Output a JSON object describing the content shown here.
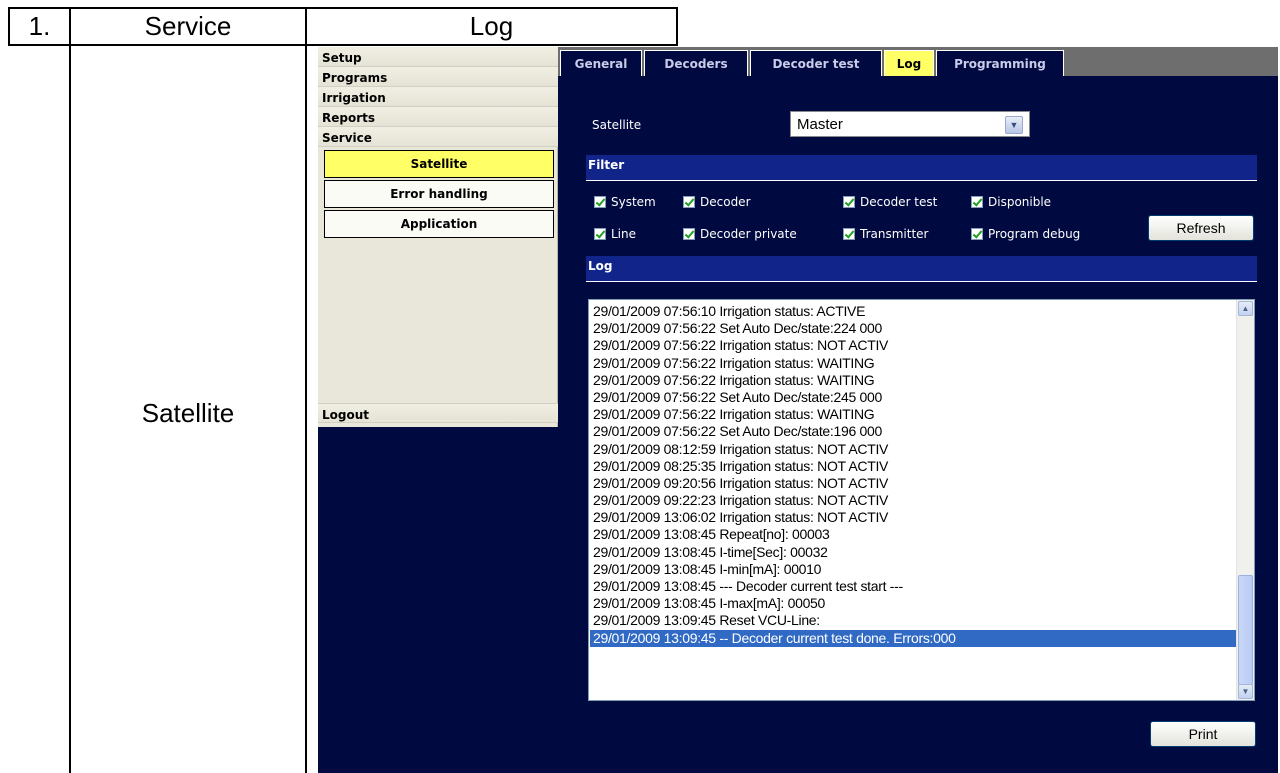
{
  "doc": {
    "number": "1.",
    "section": "Service",
    "subsection": "Log",
    "left_label": "Satellite"
  },
  "app": {
    "menu": [
      "Setup",
      "Programs",
      "Irrigation",
      "Reports",
      "Service"
    ],
    "submenu": [
      {
        "label": "Satellite",
        "active": true
      },
      {
        "label": "Error handling",
        "active": false
      },
      {
        "label": "Application",
        "active": false
      }
    ],
    "logout": "Logout",
    "tabs": [
      {
        "label": "General",
        "active": false
      },
      {
        "label": "Decoders",
        "active": false
      },
      {
        "label": "Decoder test",
        "active": false
      },
      {
        "label": "Log",
        "active": true
      },
      {
        "label": "Programming",
        "active": false
      }
    ],
    "satellite_label": "Satellite",
    "satellite_value": "Master",
    "filter_title": "Filter",
    "filters": [
      {
        "label": "System",
        "checked": true
      },
      {
        "label": "Decoder",
        "checked": true
      },
      {
        "label": "Decoder test",
        "checked": true
      },
      {
        "label": "Disponible",
        "checked": true
      },
      {
        "label": "Line",
        "checked": true
      },
      {
        "label": "Decoder private",
        "checked": true
      },
      {
        "label": "Transmitter",
        "checked": true
      },
      {
        "label": "Program debug",
        "checked": true
      }
    ],
    "refresh_label": "Refresh",
    "log_title": "Log",
    "log_lines": [
      "29/01/2009 07:56:10 Irrigation status: ACTIVE",
      "29/01/2009 07:56:22 Set Auto Dec/state:224 000",
      "29/01/2009 07:56:22 Irrigation status: NOT ACTIV",
      "29/01/2009 07:56:22 Irrigation status: WAITING",
      "29/01/2009 07:56:22 Irrigation status: WAITING",
      "29/01/2009 07:56:22 Set Auto Dec/state:245 000",
      "29/01/2009 07:56:22 Irrigation status: WAITING",
      "29/01/2009 07:56:22 Set Auto Dec/state:196 000",
      "29/01/2009 08:12:59 Irrigation status: NOT ACTIV",
      "29/01/2009 08:25:35 Irrigation status: NOT ACTIV",
      "29/01/2009 09:20:56 Irrigation status: NOT ACTIV",
      "29/01/2009 09:22:23 Irrigation status: NOT ACTIV",
      "29/01/2009 13:06:02 Irrigation status: NOT ACTIV",
      "29/01/2009 13:08:45 Repeat[no]: 00003",
      "29/01/2009 13:08:45 I-time[Sec]: 00032",
      "29/01/2009 13:08:45 I-min[mA]: 00010",
      "29/01/2009 13:08:45 --- Decoder current test start ---",
      "29/01/2009 13:08:45 I-max[mA]: 00050",
      "29/01/2009 13:09:45 Reset VCU-Line:",
      "29/01/2009 13:09:45 -- Decoder current test done. Errors:000"
    ],
    "selected_log_index": 19,
    "print_label": "Print"
  }
}
